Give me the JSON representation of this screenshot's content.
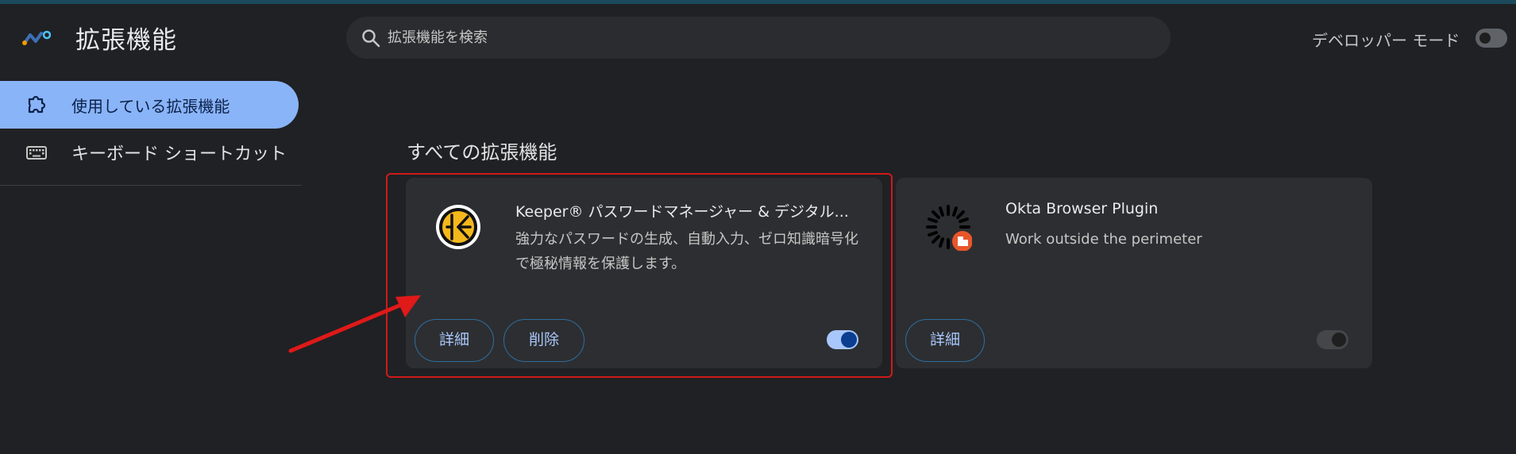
{
  "header": {
    "title": "拡張機能",
    "search_placeholder": "拡張機能を検索",
    "dev_mode_label": "デベロッパー モード",
    "dev_mode_enabled": false
  },
  "sidebar": {
    "items": [
      {
        "label": "使用している拡張機能",
        "icon": "puzzle-icon",
        "active": true
      },
      {
        "label": "キーボード ショートカット",
        "icon": "keyboard-icon",
        "active": false
      }
    ]
  },
  "main": {
    "section_title": "すべての拡張機能",
    "extensions": [
      {
        "name": "Keeper® パスワードマネージャー & デジタル...",
        "description": "強力なパスワードの生成、自動入力、ゼロ知識暗号化で極秘情報を保護します。",
        "icon": "keeper-icon",
        "details_label": "詳細",
        "remove_label": "削除",
        "enabled": true
      },
      {
        "name": "Okta Browser Plugin",
        "description": "Work outside the perimeter",
        "icon": "okta-icon",
        "details_label": "詳細",
        "enabled": false
      }
    ]
  },
  "colors": {
    "background": "#202124",
    "accent": "#8ab4f8",
    "highlight_border": "#d01a1a"
  }
}
